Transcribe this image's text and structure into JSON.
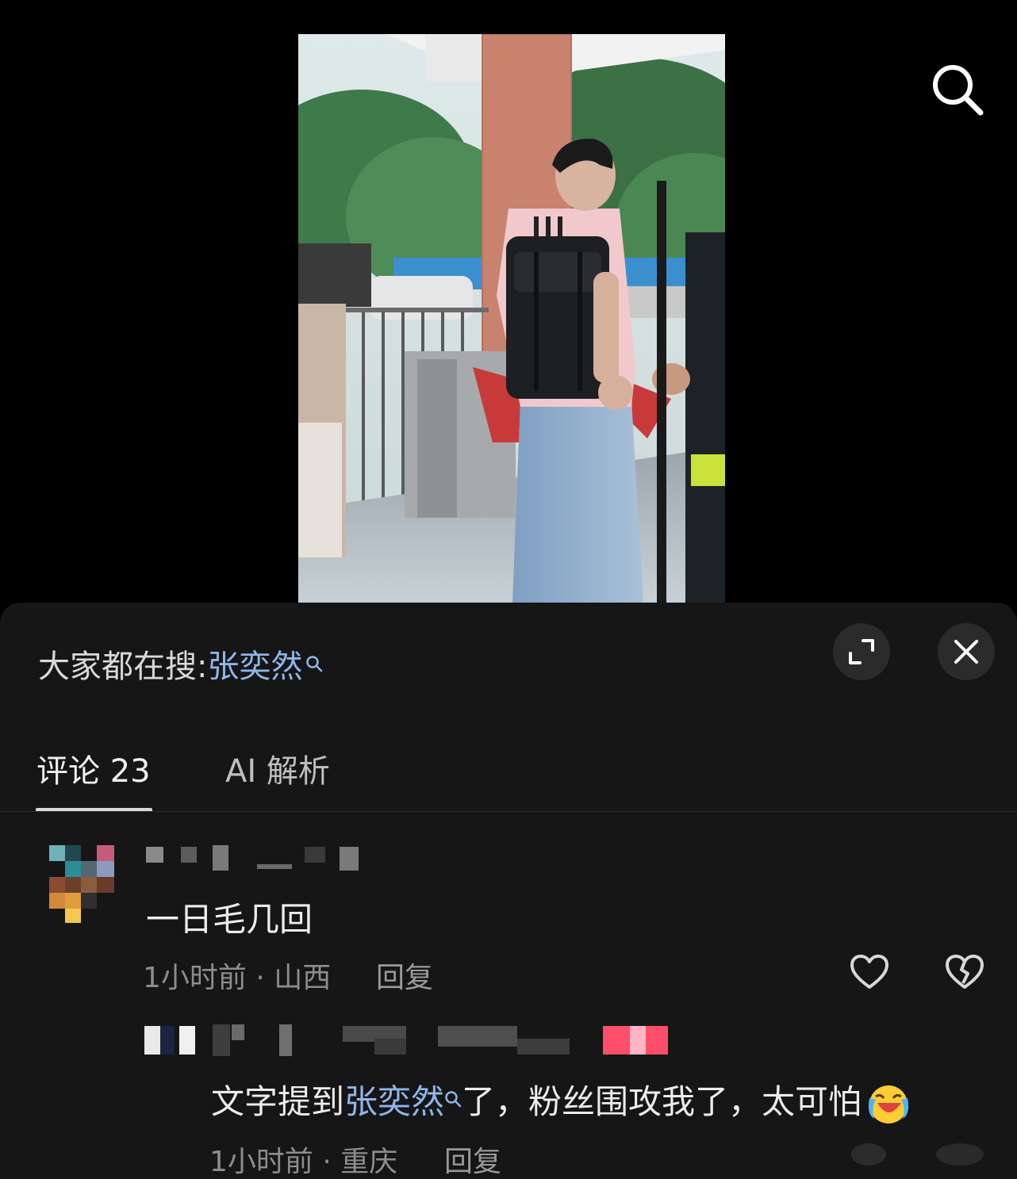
{
  "hot_search": {
    "prefix": "大家都在搜:",
    "term": "张奕然"
  },
  "tabs": [
    {
      "label": "评论 23",
      "active": true
    },
    {
      "label": "AI 解析",
      "active": false
    }
  ],
  "comments": [
    {
      "text": "一日毛几回",
      "time": "1小时前 · 山西",
      "reply": "回复",
      "is_reply": false
    },
    {
      "text_before": "文字提到",
      "text_term": "张奕然",
      "text_after": "了，粉丝围攻我了，太可怕",
      "emoji": "laughing-crying-emoji",
      "time": "1小时前 · 重庆",
      "reply": "回复",
      "is_reply": true
    }
  ],
  "icons": {
    "top_search": "search-icon",
    "expand": "expand-icon",
    "close": "close-icon",
    "like": "heart-icon",
    "dislike": "broken-heart-icon"
  },
  "colors": {
    "sheet_bg": "#161616",
    "link_blue": "#8fb6ea",
    "meta_gray": "#8d8d8d"
  }
}
